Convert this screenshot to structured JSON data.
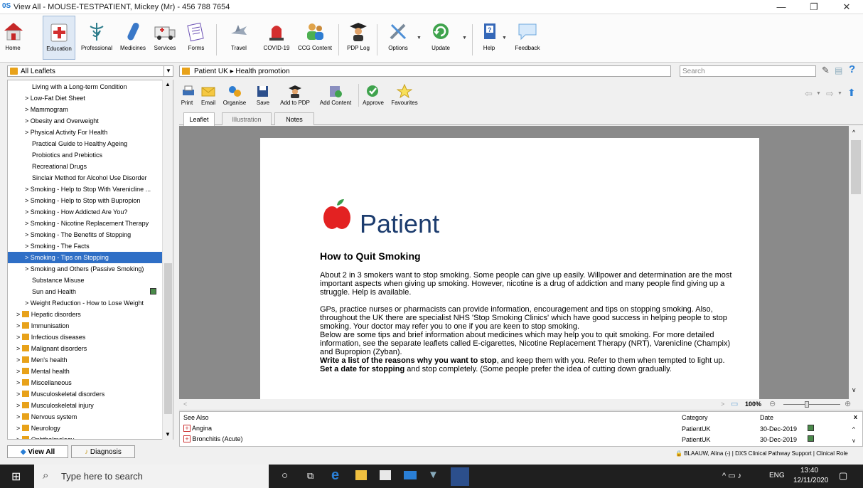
{
  "window": {
    "title": "View All  -  MOUSE-TESTPATIENT, Mickey (Mr) - 456 788 7654",
    "logo": "0S"
  },
  "toolbar": [
    {
      "label": "Home",
      "icon": "home-icon"
    },
    {
      "label": "Education",
      "icon": "education-icon"
    },
    {
      "label": "Professional",
      "icon": "caduceus-icon"
    },
    {
      "label": "Medicines",
      "icon": "capsule-icon"
    },
    {
      "label": "Services",
      "icon": "ambulance-icon"
    },
    {
      "label": "Forms",
      "icon": "forms-icon"
    },
    {
      "label": "Travel",
      "icon": "travel-icon"
    },
    {
      "label": "COVID-19",
      "icon": "alarm-light-icon"
    },
    {
      "label": "CCG Content",
      "icon": "people-icon"
    },
    {
      "label": "PDP Log",
      "icon": "graduate-icon"
    },
    {
      "label": "Options",
      "icon": "tools-icon"
    },
    {
      "label": "Update",
      "icon": "update-icon"
    },
    {
      "label": "Help",
      "icon": "help-book-icon"
    },
    {
      "label": "Feedback",
      "icon": "speech-bubble-icon"
    }
  ],
  "left_panel": {
    "combo_value": "All Leaflets",
    "tree": [
      {
        "label": "Living with a Long-term Condition",
        "indent": 1,
        "arrow": false
      },
      {
        "label": "Low-Fat Diet Sheet",
        "indent": 1,
        "arrow": true
      },
      {
        "label": "Mammogram",
        "indent": 1,
        "arrow": true
      },
      {
        "label": "Obesity and Overweight",
        "indent": 1,
        "arrow": true
      },
      {
        "label": "Physical Activity For Health",
        "indent": 1,
        "arrow": true
      },
      {
        "label": "Practical Guide to Healthy Ageing",
        "indent": 1,
        "arrow": false
      },
      {
        "label": "Probiotics and Prebiotics",
        "indent": 1,
        "arrow": false
      },
      {
        "label": "Recreational Drugs",
        "indent": 1,
        "arrow": false
      },
      {
        "label": "Sinclair Method for Alcohol Use Disorder",
        "indent": 1,
        "arrow": false
      },
      {
        "label": "Smoking - Help to Stop With Varenicline ...",
        "indent": 1,
        "arrow": true
      },
      {
        "label": "Smoking - Help to Stop with Bupropion",
        "indent": 1,
        "arrow": true
      },
      {
        "label": "Smoking - How Addicted Are You?",
        "indent": 1,
        "arrow": true
      },
      {
        "label": "Smoking - Nicotine Replacement Therapy",
        "indent": 1,
        "arrow": true
      },
      {
        "label": "Smoking - The Benefits of Stopping",
        "indent": 1,
        "arrow": true
      },
      {
        "label": "Smoking - The Facts",
        "indent": 1,
        "arrow": true
      },
      {
        "label": "Smoking - Tips on Stopping",
        "indent": 1,
        "arrow": true,
        "selected": true
      },
      {
        "label": "Smoking and Others (Passive Smoking)",
        "indent": 1,
        "arrow": true
      },
      {
        "label": "Substance Misuse",
        "indent": 1,
        "arrow": false
      },
      {
        "label": "Sun and Health",
        "indent": 1,
        "arrow": false,
        "badge": true
      },
      {
        "label": "Weight Reduction - How to Lose Weight",
        "indent": 1,
        "arrow": true
      },
      {
        "label": "Hepatic disorders",
        "indent": 0,
        "folder": true
      },
      {
        "label": "Immunisation",
        "indent": 0,
        "folder": true
      },
      {
        "label": "Infectious diseases",
        "indent": 0,
        "folder": true
      },
      {
        "label": "Malignant disorders",
        "indent": 0,
        "folder": true
      },
      {
        "label": "Men's health",
        "indent": 0,
        "folder": true
      },
      {
        "label": "Mental health",
        "indent": 0,
        "folder": true
      },
      {
        "label": "Miscellaneous",
        "indent": 0,
        "folder": true
      },
      {
        "label": "Musculoskeletal disorders",
        "indent": 0,
        "folder": true
      },
      {
        "label": "Musculoskeletal injury",
        "indent": 0,
        "folder": true
      },
      {
        "label": "Nervous system",
        "indent": 0,
        "folder": true
      },
      {
        "label": "Neurology",
        "indent": 0,
        "folder": true
      },
      {
        "label": "Ophthalmology",
        "indent": 0,
        "folder": true
      }
    ],
    "tabs": {
      "view_all": "View All",
      "diagnosis": "Diagnosis"
    }
  },
  "breadcrumb": {
    "root": "Patient UK",
    "sep": "▸",
    "leaf": "Health promotion"
  },
  "search": {
    "placeholder": "Search"
  },
  "actions": [
    {
      "label": "Print",
      "icon": "print-icon"
    },
    {
      "label": "Email",
      "icon": "email-icon"
    },
    {
      "label": "Organise",
      "icon": "organise-icon"
    },
    {
      "label": "Save",
      "icon": "save-icon"
    },
    {
      "label": "Add to PDP",
      "icon": "add-pdp-icon"
    },
    {
      "label": "Add Content",
      "icon": "add-content-icon"
    },
    {
      "label": "Approve",
      "icon": "approve-icon"
    },
    {
      "label": "Favourites",
      "icon": "star-icon"
    }
  ],
  "doc_tabs": [
    "Leaflet",
    "Illustration",
    "Notes"
  ],
  "document": {
    "brand": "Patient",
    "heading": "How to Quit Smoking",
    "p1": "About 2 in 3 smokers want to stop smoking. Some people can give up easily. Willpower and determination are the most important aspects when giving up smoking. However, nicotine is a drug of addiction and many people find giving up a struggle. Help is available.",
    "p2": "GPs, practice nurses or pharmacists can provide information, encouragement and tips on stopping smoking. Also, throughout the UK there are specialist NHS 'Stop Smoking Clinics' which have good success in helping people to stop smoking. Your doctor may refer you to one if you are keen to stop smoking.",
    "p3": "Below are some tips and brief information about medicines which may help you to quit smoking. For more detailed information, see the separate leaflets called E-cigarettes, Nicotine Replacement Therapy (NRT), Varenicline (Champix) and Bupropion (Zyban).",
    "p4_bold": "Write a list of the reasons why you want to stop",
    "p4_rest": ", and keep them with you. Refer to them when tempted to light up.",
    "p5_bold": "Set a date for stopping",
    "p5_rest": " and stop completely. (Some people prefer the idea of cutting down gradually."
  },
  "zoom": {
    "level": "100%"
  },
  "see_also": {
    "headers": {
      "see_also": "See Also",
      "category": "Category",
      "date": "Date"
    },
    "rows": [
      {
        "title": "Angina",
        "category": "PatientUK",
        "date": "30-Dec-2019"
      },
      {
        "title": "Bronchitis (Acute)",
        "category": "PatientUK",
        "date": "30-Dec-2019"
      }
    ]
  },
  "status": {
    "user": "BLAAUW, Alina (-)",
    "app": "DXS Clinical Pathway Support",
    "role": "Clinical Role"
  },
  "taskbar": {
    "search_placeholder": "Type here to search",
    "lang": "ENG",
    "time": "13:40",
    "date": "12/11/2020"
  },
  "colors": {
    "selection": "#2f6fc6",
    "folder": "#e8a21a",
    "brand_red": "#e32222",
    "brand_text": "#1c3c6e"
  }
}
